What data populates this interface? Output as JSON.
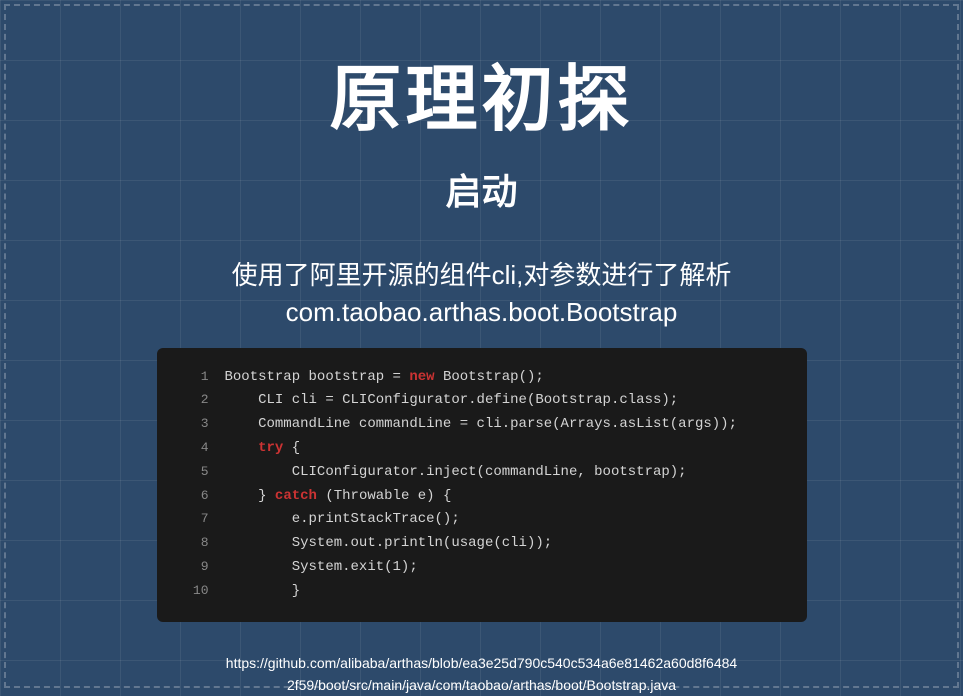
{
  "page": {
    "title": "原理初探",
    "subtitle": "启动",
    "description_line1": "使用了阿里开源的组件cli,对参数进行了解析",
    "description_line2": "com.taobao.arthas.boot.Bootstrap",
    "code": {
      "lines": [
        {
          "num": "1",
          "content": "Bootstrap bootstrap = ",
          "keyword": "new",
          "rest": " Bootstrap();"
        },
        {
          "num": "2",
          "plain": "    CLI cli = CLIConfigurator.define(Bootstrap.class);"
        },
        {
          "num": "3",
          "plain": "    CommandLine commandLine = cli.parse(Arrays.asList(args));"
        },
        {
          "num": "4",
          "keyword_only": "try",
          "rest": " {"
        },
        {
          "num": "5",
          "plain": "        CLIConfigurator.inject(commandLine, bootstrap);"
        },
        {
          "num": "6",
          "pre": "    } ",
          "keyword_only": "catch",
          "rest": " (Throwable e) {"
        },
        {
          "num": "7",
          "plain": "        e.printStackTrace();"
        },
        {
          "num": "8",
          "plain": "        System.out.println(usage(cli));"
        },
        {
          "num": "9",
          "plain": "        System.exit(1);"
        },
        {
          "num": "10",
          "plain": "        }"
        }
      ]
    },
    "footer": {
      "line1": "https://github.com/alibaba/arthas/blob/ea3e25d790c540c534a6e81462a60d8f6484",
      "line2": "2f59/boot/src/main/java/com/taobao/arthas/boot/Bootstrap.java"
    }
  }
}
